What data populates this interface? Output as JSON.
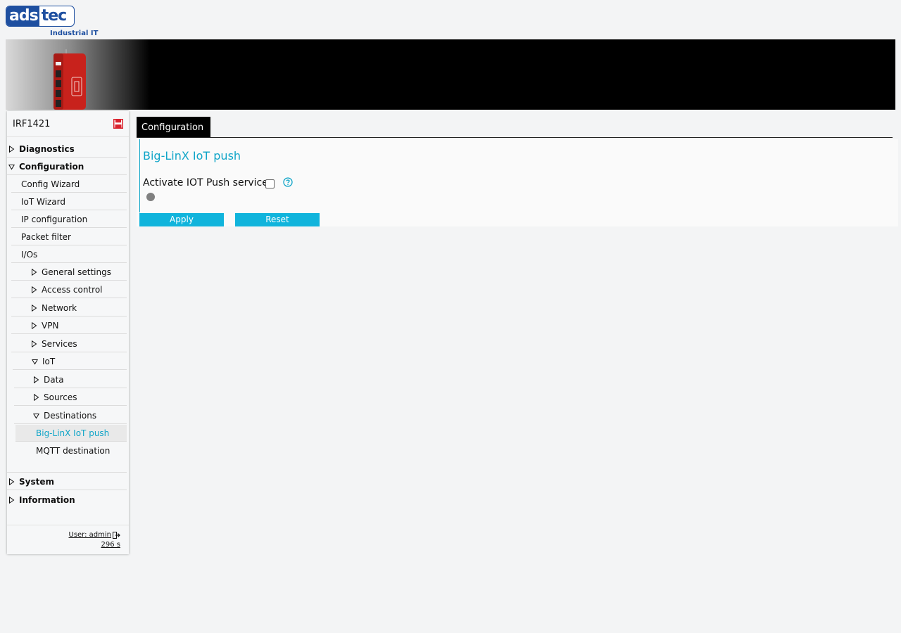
{
  "brand": {
    "logo_ads": "ads",
    "logo_tec": "tec",
    "logo_sub": "Industrial IT"
  },
  "sidebar": {
    "device_name": "IRF1421",
    "items": [
      {
        "label": "Diagnostics"
      },
      {
        "label": "Configuration"
      },
      {
        "label": "Config Wizard"
      },
      {
        "label": "IoT Wizard"
      },
      {
        "label": "IP configuration"
      },
      {
        "label": "Packet filter"
      },
      {
        "label": "I/Os"
      },
      {
        "label": "General settings"
      },
      {
        "label": "Access control"
      },
      {
        "label": "Network"
      },
      {
        "label": "VPN"
      },
      {
        "label": "Services"
      },
      {
        "label": "IoT"
      },
      {
        "label": "Data"
      },
      {
        "label": "Sources"
      },
      {
        "label": "Destinations"
      },
      {
        "label": "Big-LinX IoT push"
      },
      {
        "label": "MQTT destination"
      },
      {
        "label": "System"
      },
      {
        "label": "Information"
      }
    ],
    "user_label": "User: admin",
    "timer": "296 s"
  },
  "main": {
    "tab_label": "Configuration",
    "title": "Big-LinX IoT push",
    "activate_label": "Activate IOT Push service:",
    "activate_checked": false,
    "apply_label": "Apply",
    "reset_label": "Reset"
  },
  "colors": {
    "accent": "#10a5c8",
    "button": "#10b4dc",
    "brand_blue": "#1e4fa0",
    "save_red": "#d9232e"
  }
}
